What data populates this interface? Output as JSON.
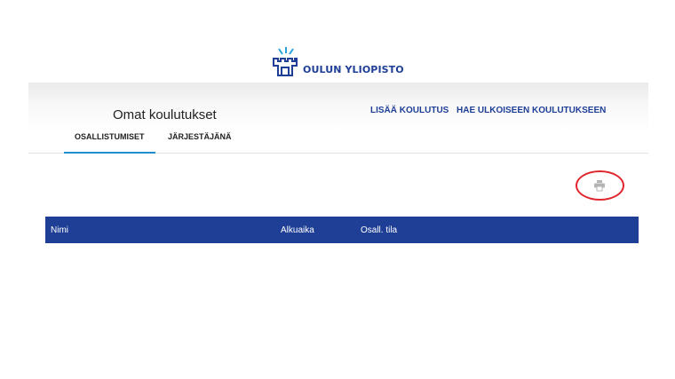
{
  "brand": {
    "name": "OULUN YLIOPISTO",
    "color": "#1f3f97",
    "icon": "university-castle-logo-icon"
  },
  "header": {
    "title": "Omat koulutukset",
    "tabs": [
      {
        "label": "OSALLISTUMISET",
        "active": true
      },
      {
        "label": "JÄRJESTÄJÄNÄ",
        "active": false
      }
    ],
    "actions": [
      {
        "label": "LISÄÄ KOULUTUS"
      },
      {
        "label": "HAE ULKOISEEN KOULUTUKSEEN"
      }
    ]
  },
  "toolbar": {
    "print_icon": "print-icon",
    "highlight_color": "#e0252d"
  },
  "table": {
    "header_color": "#1f3f97",
    "columns": [
      "Nimi",
      "Alkuaika",
      "Osall. tila"
    ],
    "rows": []
  }
}
